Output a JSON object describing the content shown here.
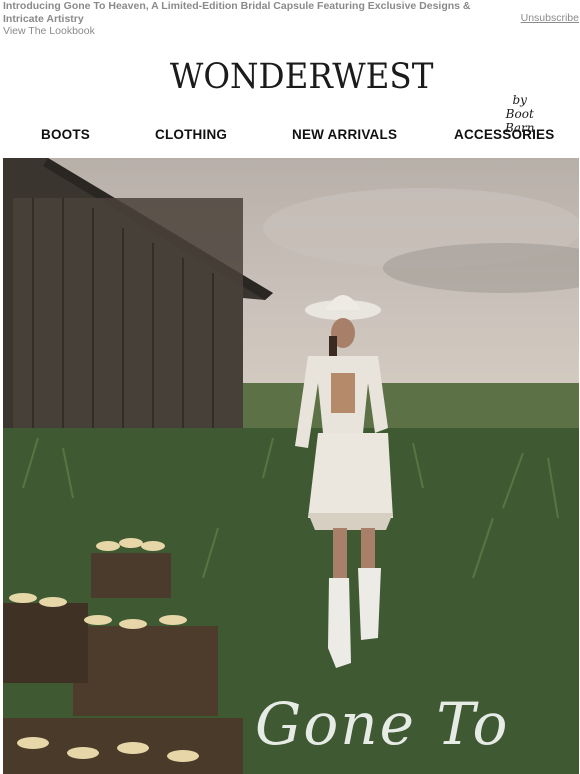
{
  "preheader": {
    "text": "Introducing Gone To Heaven, A Limited-Edition Bridal Capsule Featuring Exclusive Designs & Intricate Artistry",
    "lookbook_link": "View The Lookbook",
    "unsubscribe": "Unsubscribe"
  },
  "brand": {
    "name": "WONDERWEST",
    "byline": "by Boot Barn"
  },
  "nav": {
    "items": [
      "BOOTS",
      "CLOTHING",
      "NEW ARRIVALS",
      "ACCESSORIES"
    ]
  },
  "hero": {
    "script_text": "Gone To"
  }
}
